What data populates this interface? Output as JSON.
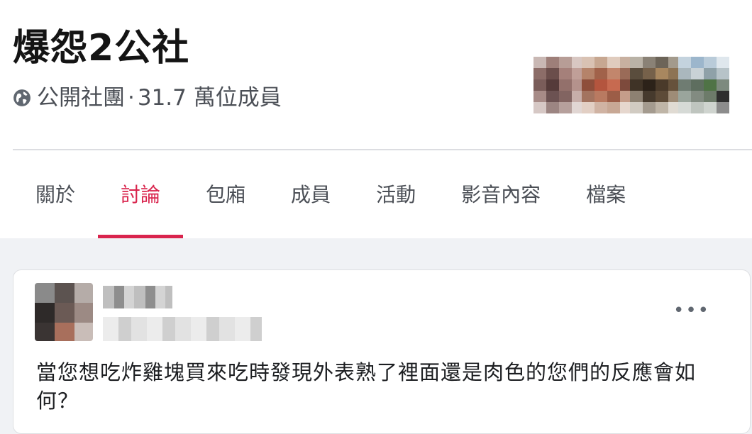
{
  "group": {
    "name": "爆怨2公社",
    "privacy": "公開社團",
    "separator": "·",
    "members": "31.7 萬位成員"
  },
  "icons": {
    "privacy": "globe-icon",
    "more": "more-options-icon"
  },
  "tabs": [
    {
      "label": "關於",
      "active": false
    },
    {
      "label": "討論",
      "active": true
    },
    {
      "label": "包廂",
      "active": false
    },
    {
      "label": "成員",
      "active": false
    },
    {
      "label": "活動",
      "active": false
    },
    {
      "label": "影音內容",
      "active": false
    },
    {
      "label": "檔案",
      "active": false
    }
  ],
  "post": {
    "more_label": "•••",
    "text": "當您想吃炸雞塊買來吃時發現外表熟了裡面還是肉色的您們的反應會如何？"
  },
  "colors": {
    "accent": "#d9244d",
    "background": "#f0f2f5",
    "card": "#ffffff"
  }
}
